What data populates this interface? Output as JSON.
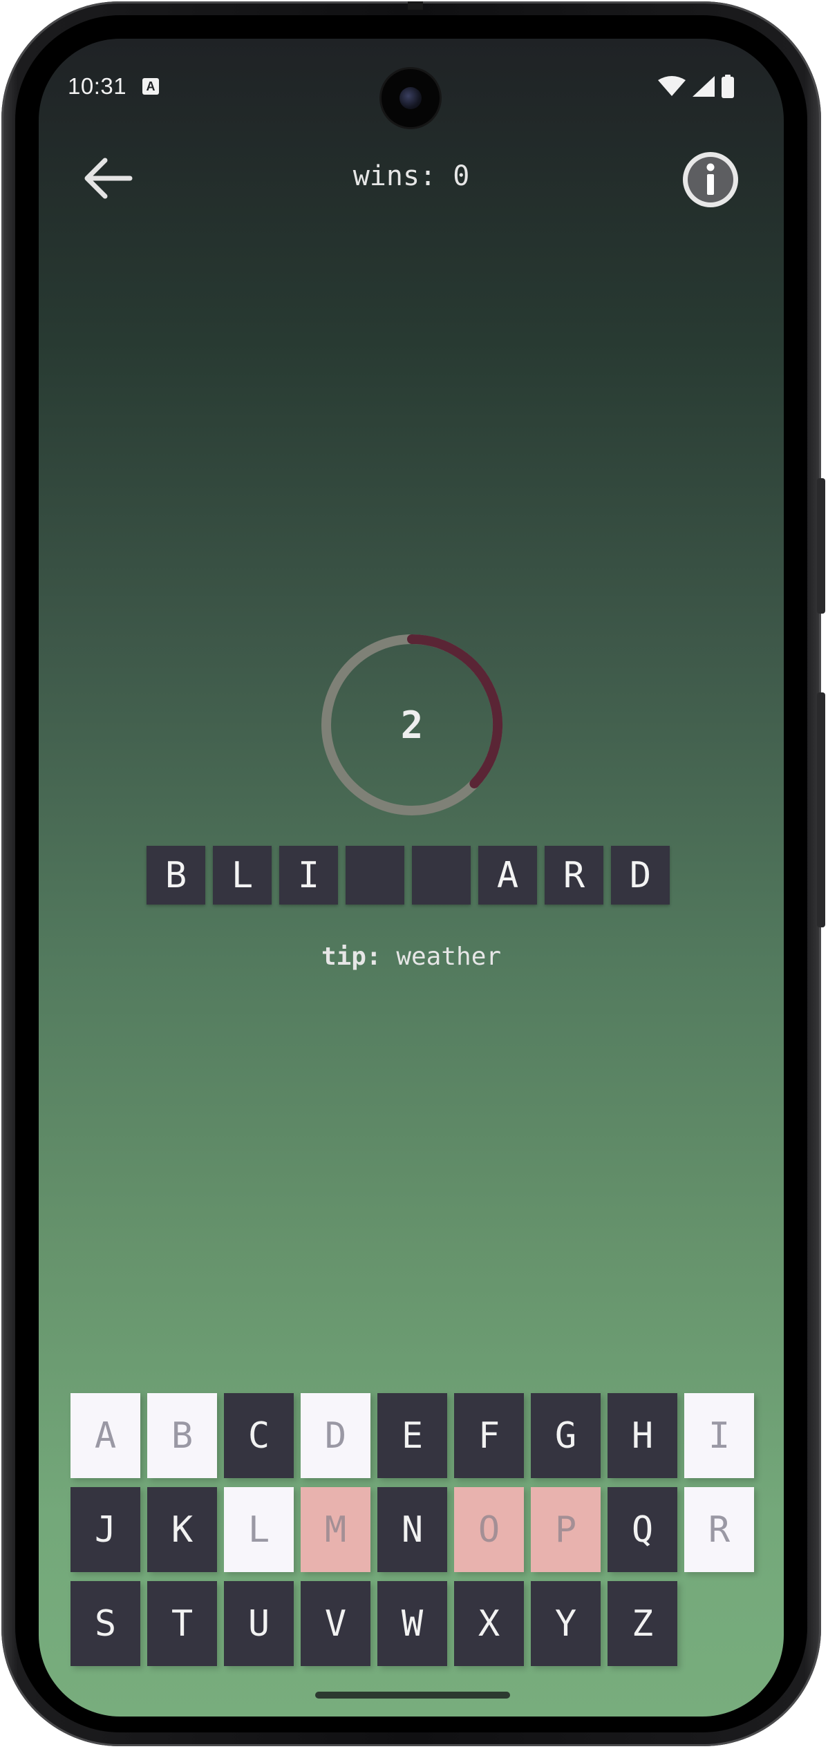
{
  "status_bar": {
    "time": "10:31",
    "notification_icon": "a-icon",
    "icons": [
      "wifi-icon",
      "cellular-signal-icon",
      "battery-icon"
    ]
  },
  "header": {
    "back_icon": "arrow-left-icon",
    "wins_label": "wins: 0",
    "info_icon": "info-icon"
  },
  "timer": {
    "value": "2",
    "remaining_fraction": 0.37,
    "track_color": "#7f8177",
    "progress_color": "#5a2535"
  },
  "word": {
    "slots": [
      "B",
      "L",
      "I",
      "",
      "",
      "A",
      "R",
      "D"
    ]
  },
  "tip": {
    "label": "tip:",
    "value": "weather"
  },
  "keyboard": {
    "keys": [
      {
        "letter": "A",
        "state": "used"
      },
      {
        "letter": "B",
        "state": "used"
      },
      {
        "letter": "C",
        "state": "default"
      },
      {
        "letter": "D",
        "state": "used"
      },
      {
        "letter": "E",
        "state": "default"
      },
      {
        "letter": "F",
        "state": "default"
      },
      {
        "letter": "G",
        "state": "default"
      },
      {
        "letter": "H",
        "state": "default"
      },
      {
        "letter": "I",
        "state": "used"
      },
      {
        "letter": "J",
        "state": "default"
      },
      {
        "letter": "K",
        "state": "default"
      },
      {
        "letter": "L",
        "state": "used"
      },
      {
        "letter": "M",
        "state": "wrong"
      },
      {
        "letter": "N",
        "state": "default"
      },
      {
        "letter": "O",
        "state": "wrong"
      },
      {
        "letter": "P",
        "state": "wrong"
      },
      {
        "letter": "Q",
        "state": "default"
      },
      {
        "letter": "R",
        "state": "used"
      },
      {
        "letter": "S",
        "state": "default"
      },
      {
        "letter": "T",
        "state": "default"
      },
      {
        "letter": "U",
        "state": "default"
      },
      {
        "letter": "V",
        "state": "default"
      },
      {
        "letter": "W",
        "state": "default"
      },
      {
        "letter": "X",
        "state": "default"
      },
      {
        "letter": "Y",
        "state": "default"
      },
      {
        "letter": "Z",
        "state": "default"
      }
    ],
    "colors": {
      "default": "#353440",
      "used": "#f8f6fb",
      "wrong": "#e8b2ae"
    }
  }
}
